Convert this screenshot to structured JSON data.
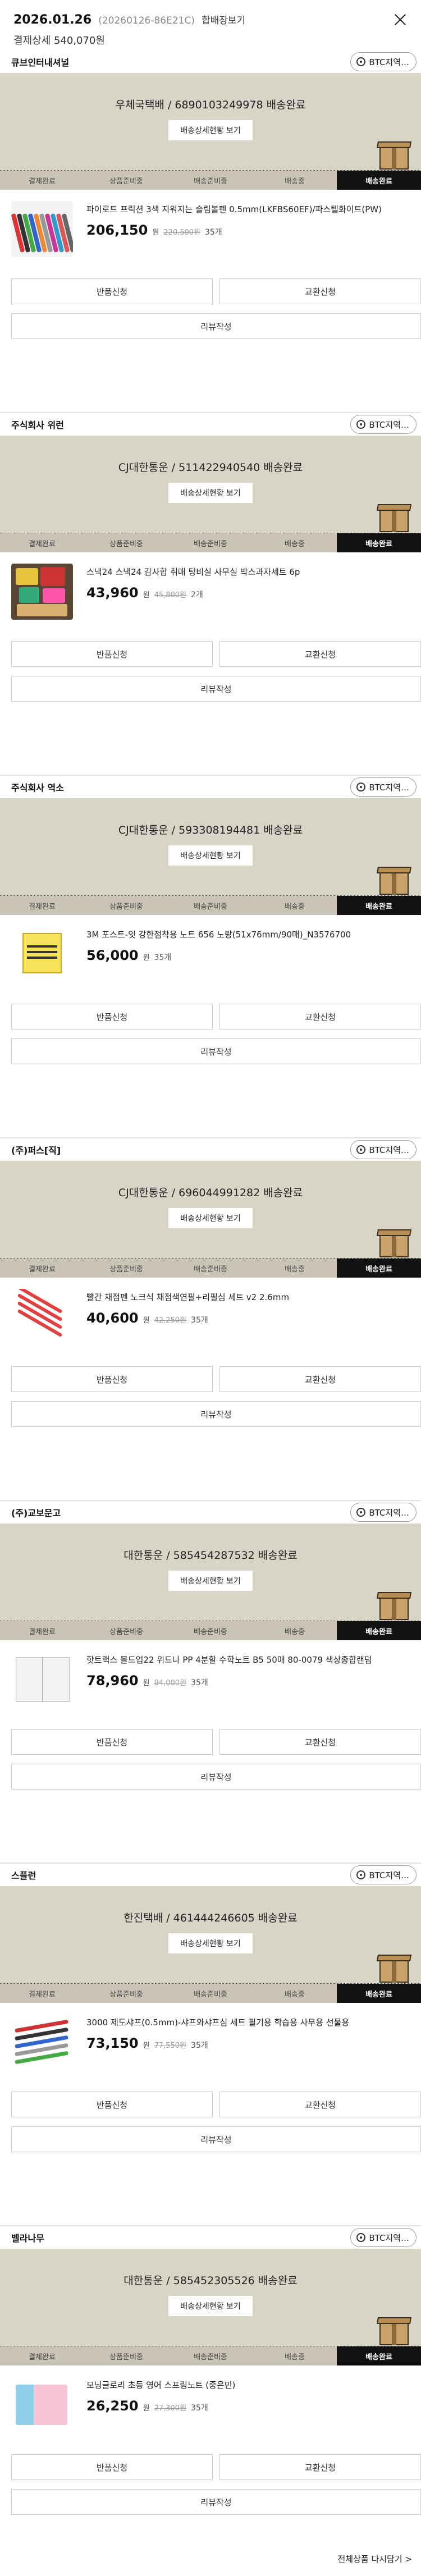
{
  "header": {
    "date": "2026.01.26",
    "order_id": "(20260126-86E21C)",
    "detail_link": "합배장보기",
    "payment_summary": "결제상세 540,070원"
  },
  "common": {
    "track_button": "배송상세현황 보기",
    "btc_button": "BTC지역…",
    "return_button": "반품신청",
    "exchange_button": "교환신청",
    "review_button": "리뷰작성",
    "won": "원",
    "steps": [
      "결제완료",
      "상품준비중",
      "배송준비중",
      "배송중",
      "배송완료"
    ],
    "active_step": 4
  },
  "sellers": [
    {
      "name": "큐브인터내셔널",
      "carrier_line": "우체국택배 / 6890103249978 배송완료",
      "product": {
        "name": "파이로트 프릭션 3색 지워지는 슬림볼펜 0.5mm(LKFBS60EF)/파스텔화이트(PW)",
        "price": "206,150",
        "original": "220,500원",
        "qty": "35개"
      }
    },
    {
      "name": "주식회사 위런",
      "carrier_line": "CJ대한통운 / 511422940540 배송완료",
      "product": {
        "name": "스낵24 스낵24 감사합 취매 탕비실 사무실 박스과자세트 6p",
        "price": "43,960",
        "original": "45,800원",
        "qty": "2개"
      }
    },
    {
      "name": "주식회사 역소",
      "carrier_line": "CJ대한통운 / 593308194481 배송완료",
      "product": {
        "name": "3M 포스트-잇 강한점착용 노트 656 노랑(51x76mm/90매)_N3576700",
        "price": "56,000",
        "original": "",
        "qty": "35개"
      }
    },
    {
      "name": "(주)퍼스[직]",
      "carrier_line": "CJ대한통운 / 696044991282 배송완료",
      "product": {
        "name": "빨간 채점펜 노크식 채점색연필+리필심 세트 v2 2.6mm",
        "price": "40,600",
        "original": "42,250원",
        "qty": "35개"
      }
    },
    {
      "name": "(주)교보문고",
      "carrier_line": "대한통운 / 585454287532 배송완료",
      "product": {
        "name": "핫트랙스 몰드업22 위드나 PP 4분할 수학노트 B5 50매 80-0079 색상종합랜덤",
        "price": "78,960",
        "original": "84,000원",
        "qty": "35개"
      }
    },
    {
      "name": "스플런",
      "carrier_line": "한진택배 / 461444246605 배송완료",
      "product": {
        "name": "3000 제도샤프(0.5mm)-샤프와샤프심 세트 필기용 학습용 사무용 선물용",
        "price": "73,150",
        "original": "77,550원",
        "qty": "35개"
      }
    },
    {
      "name": "벨라나무",
      "carrier_line": "대한통운 / 585452305526 배송완료",
      "product": {
        "name": "모닝글로리 초등 영어 스프링노트 (중은민)",
        "price": "26,250",
        "original": "27,300원",
        "qty": "35개"
      }
    }
  ],
  "footer": {
    "reorder_link": "전체상품 다시담기 >"
  }
}
